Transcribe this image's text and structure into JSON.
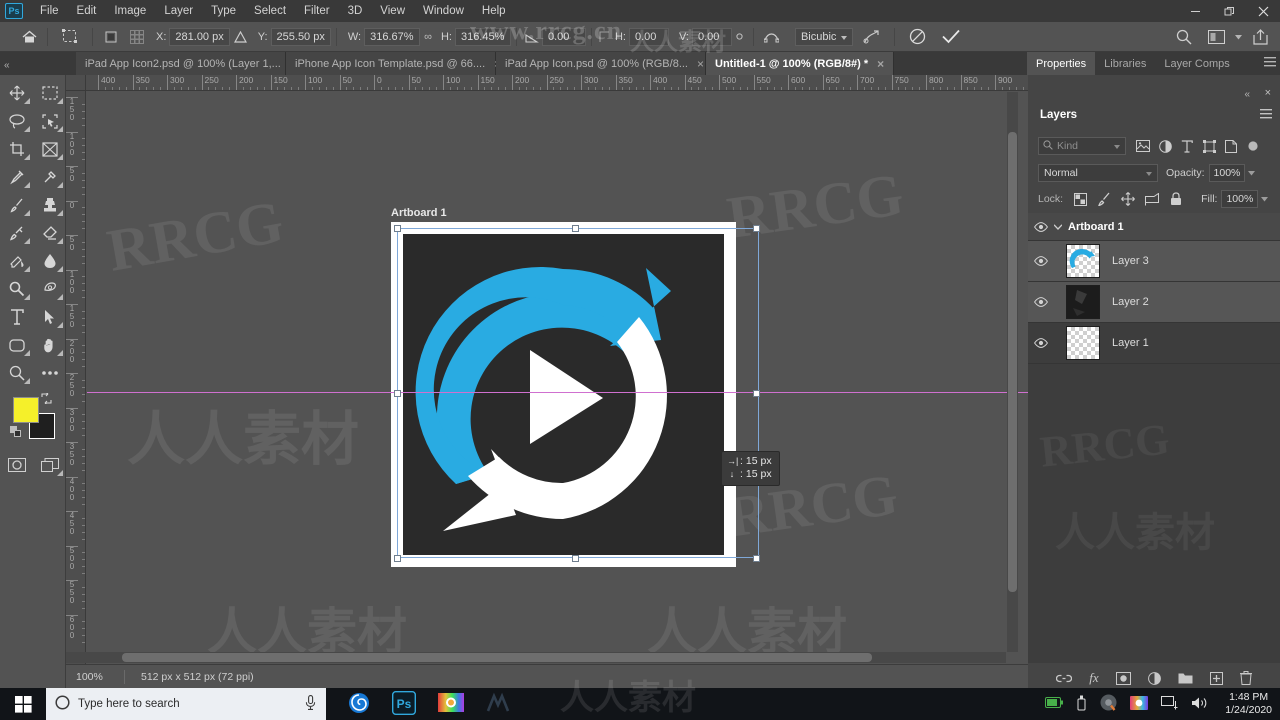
{
  "app": {
    "logo": "Ps"
  },
  "menubar": {
    "items": [
      "File",
      "Edit",
      "Image",
      "Layer",
      "Type",
      "Select",
      "Filter",
      "3D",
      "View",
      "Window",
      "Help"
    ],
    "window_controls": {
      "minimize": "—",
      "restore": "❐",
      "close": "✕"
    }
  },
  "options_bar": {
    "home_icon": "home-icon",
    "tool_icon": "free-transform-icon",
    "ref_point_icon": "reference-point-icon",
    "fields": [
      {
        "label": "X:",
        "value": "281.00 px"
      },
      {
        "label": "Y:",
        "value": "255.50 px"
      },
      {
        "label": "W:",
        "value": "316.67%"
      },
      {
        "label": "H:",
        "value": "316.45%"
      },
      {
        "label": "",
        "value": "0.00"
      },
      {
        "label": "H:",
        "value": "0.00"
      },
      {
        "label": "V:",
        "value": "0.00"
      }
    ],
    "angle_symbol": "∆",
    "skew_symbol": "⊿",
    "link_symbol": "∞",
    "interpolation": "Bicubic",
    "warp_icon": "warp-icon",
    "cancel_icon": "cancel-transform-icon",
    "commit_icon": "commit-transform-icon",
    "search_icon": "search-icon",
    "workspace_icon": "workspace-icon",
    "share_icon": "share-icon"
  },
  "document_tabs": [
    {
      "title": "iPad App Icon2.psd @ 100% (Layer 1,...",
      "close": "×",
      "active": false
    },
    {
      "title": "iPhone App Icon Template.psd @ 66....",
      "close": "×",
      "active": false
    },
    {
      "title": "iPad App Icon.psd @ 100% (RGB/8...",
      "close": "×",
      "active": false
    },
    {
      "title": "Untitled-1 @ 100% (RGB/8#) *",
      "close": "×",
      "active": true
    }
  ],
  "panel_tabs": [
    {
      "label": "Properties",
      "active": false
    },
    {
      "label": "Libraries",
      "active": false
    },
    {
      "label": "Layer Comps",
      "active": false
    }
  ],
  "toolbar": {
    "collapse": "«",
    "tools": [
      "move-tool",
      "rectangular-marquee-tool",
      "lasso-tool",
      "object-selection-tool",
      "crop-tool",
      "frame-tool",
      "eyedropper-tool",
      "spot-healing-brush-tool",
      "brush-tool",
      "clone-stamp-tool",
      "history-brush-tool",
      "eraser-tool",
      "gradient-tool",
      "blur-tool",
      "dodge-tool",
      "pen-tool",
      "type-tool",
      "path-selection-tool",
      "rectangle-tool",
      "hand-tool",
      "zoom-tool",
      "edit-toolbar-tool"
    ],
    "foreground_color": "#f5f02a",
    "background_color": "#1f1f1f",
    "swap_icon": "swap-colors-icon",
    "default_colors_icon": "default-colors-icon",
    "quick_mask_icon": "quick-mask-icon",
    "screen_mode_icon": "screen-mode-icon"
  },
  "canvas": {
    "artboard_label": "Artboard 1",
    "ruler_h_ticks": [
      "400",
      "350",
      "300",
      "250",
      "200",
      "150",
      "100",
      "50",
      "0",
      "50",
      "100",
      "150",
      "200",
      "250",
      "300",
      "350",
      "400",
      "450",
      "500",
      "550",
      "600",
      "650",
      "700",
      "750",
      "800",
      "850",
      "900"
    ],
    "ruler_v_ticks": [
      "150",
      "100",
      "50",
      "0",
      "50",
      "100",
      "150",
      "200",
      "250",
      "300",
      "350",
      "400",
      "450",
      "500",
      "550",
      "600"
    ],
    "tooltip": {
      "horizontal_icon": "→|",
      "horizontal_value": "15 px",
      "vertical_icon": "↓",
      "vertical_value": "15 px"
    },
    "artwork": {
      "background_color": "#2a2a2a",
      "blue_arrow_color": "#29abe2",
      "white_arrow_color": "#ffffff",
      "play_triangle_color": "#ffffff"
    },
    "selection_color": "#7fa8d8",
    "guide_color": "#d070d0"
  },
  "status_bar": {
    "zoom": "100%",
    "doc_info": "512 px x 512 px (72 ppi)"
  },
  "layers_panel": {
    "title": "Layers",
    "collapse_icon": "«",
    "close_icon": "×",
    "menu_icon": "panel-menu-icon",
    "filter": {
      "placeholder": "Kind",
      "search_icon": "search-icon",
      "icons": [
        "filter-pixel-icon",
        "filter-adjustment-icon",
        "filter-type-icon",
        "filter-shape-icon",
        "filter-smartobject-icon",
        "filter-toggle-icon"
      ]
    },
    "blend_mode": "Normal",
    "opacity_label": "Opacity:",
    "opacity_value": "100%",
    "lock_label": "Lock:",
    "lock_icons": [
      "lock-transparent-icon",
      "lock-image-icon",
      "lock-position-icon",
      "lock-artboard-icon",
      "lock-all-icon"
    ],
    "fill_label": "Fill:",
    "fill_value": "100%",
    "rows": [
      {
        "type": "group",
        "name": "Artboard 1",
        "visible": true,
        "expanded": true,
        "selected": false
      },
      {
        "type": "layer",
        "name": "Layer 3",
        "visible": true,
        "selected": true,
        "thumb": "blue-arrow-thumb"
      },
      {
        "type": "layer",
        "name": "Layer 2",
        "visible": true,
        "selected": true,
        "thumb": "dark-art-thumb"
      },
      {
        "type": "layer",
        "name": "Layer 1",
        "visible": true,
        "selected": false,
        "thumb": "transparent-thumb"
      }
    ],
    "footer_icons": [
      "link-layers-icon",
      "layer-style-fx-icon",
      "layer-mask-icon",
      "adjustment-layer-icon",
      "new-group-icon",
      "new-layer-icon",
      "delete-layer-icon"
    ],
    "fx_label": "fx"
  },
  "taskbar": {
    "start_icon": "windows-start-icon",
    "search_placeholder": "Type here to search",
    "cortana_icon": "cortana-circle-icon",
    "mic_icon": "microphone-icon",
    "pinned": [
      "firefox-icon",
      "photoshop-icon",
      "color-app-icon",
      "media-app-icon"
    ],
    "tray_icons": [
      "battery-icon",
      "usb-icon",
      "chrome-icon",
      "color-tray-icon",
      "display-icon",
      "volume-icon"
    ],
    "time": "1:48 PM",
    "date": "1/24/2020"
  },
  "watermarks": {
    "url": "www.rrcg.cn",
    "brand": "RRCG",
    "chinese": "人人素材"
  }
}
